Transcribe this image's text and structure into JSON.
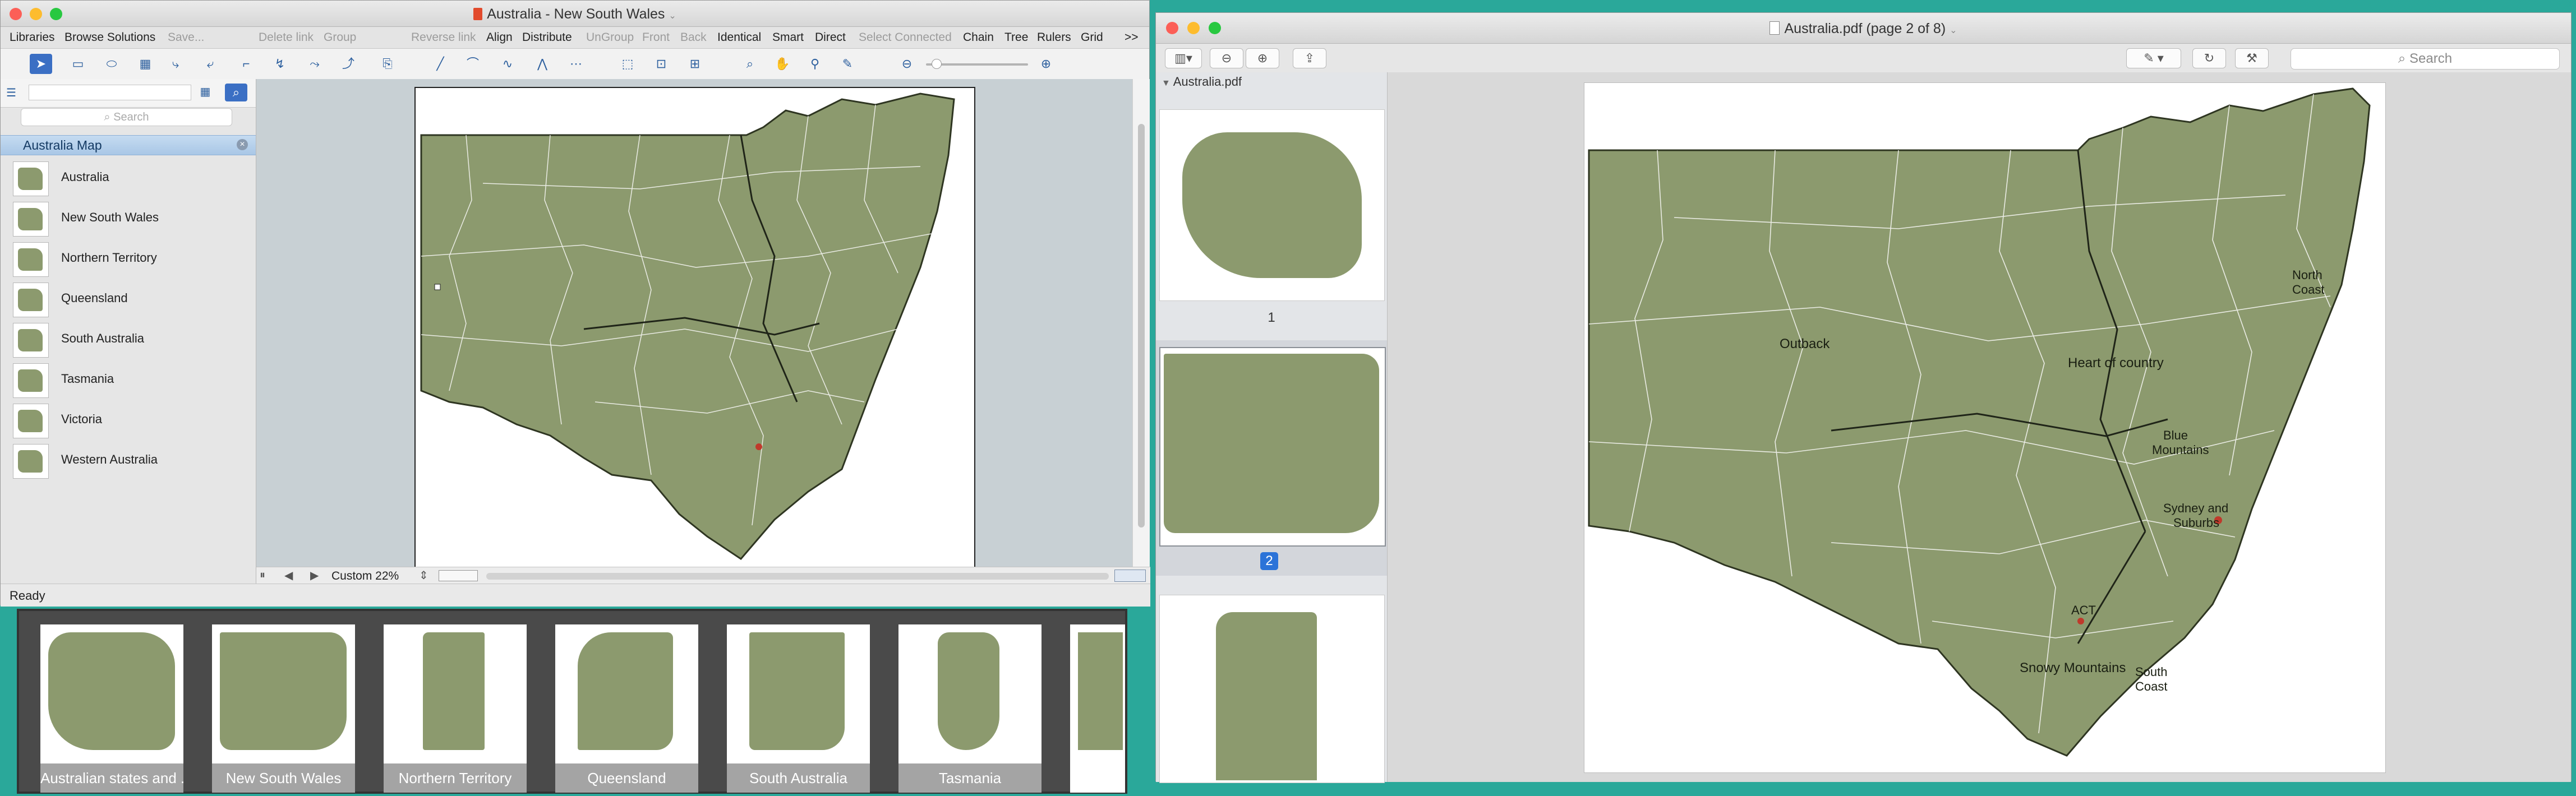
{
  "left_window": {
    "title": "Australia - New South Wales",
    "menu": [
      "Libraries",
      "Browse Solutions",
      "Save...",
      "Delete link",
      "Group",
      "Reverse link",
      "Align",
      "Distribute",
      "UnGroup",
      "Front",
      "Back",
      "Identical",
      "Smart",
      "Direct",
      "Select Connected",
      "Chain",
      "Tree",
      "Rulers",
      "Grid"
    ],
    "overflow": ">>",
    "search_placeholder": "Search",
    "library_title": "Australia Map",
    "library_items": [
      "Australia",
      "New South Wales",
      "Northern Territory",
      "Queensland",
      "South Australia",
      "Tasmania",
      "Victoria",
      "Western Australia"
    ],
    "zoom_label": "Custom 22%",
    "status": "Ready"
  },
  "filmstrip": {
    "items": [
      "Australian states and ...",
      "New South Wales",
      "Northern Territory",
      "Queensland",
      "South Australia",
      "Tasmania"
    ]
  },
  "right_window": {
    "title": "Australia.pdf (page 2 of 8)",
    "search_placeholder": "Search",
    "sidebar_file": "Australia.pdf",
    "page_numbers": [
      "1",
      "2"
    ],
    "map_labels": {
      "outback": "Outback",
      "heart": "Heart of country",
      "north_coast_1": "North",
      "north_coast_2": "Coast",
      "blue_1": "Blue",
      "blue_2": "Mountains",
      "sydney_1": "Sydney and",
      "sydney_2": "Suburbs",
      "act": "ACT",
      "snowy": "Snowy Mountains",
      "south_coast_1": "South",
      "south_coast_2": "Coast"
    }
  },
  "colors": {
    "map_fill": "#8c9a6e",
    "map_border": "#3a4229",
    "selection": "#2b73d8",
    "desktop": "#2aa89a"
  }
}
